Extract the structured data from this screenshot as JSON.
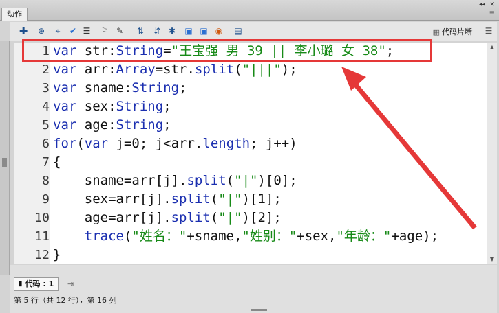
{
  "panel": {
    "tab_label": "动作",
    "window_controls": [
      "◂◂",
      "✕"
    ],
    "menu_icon": "≡"
  },
  "toolbar": {
    "icons": [
      "add-icon",
      "target-icon",
      "crosshair-icon",
      "check-icon",
      "format-icon",
      "debug-icon",
      "script-assist-icon",
      "collapse-icon",
      "expand-icon",
      "expand-all-icon",
      "comment-icon",
      "uncomment-icon",
      "toggle-comment-icon",
      "help-icon"
    ],
    "snippets_label": "代码片断"
  },
  "code": {
    "lines": [
      {
        "n": "1",
        "tokens": [
          [
            "kw",
            "var"
          ],
          [
            "id",
            " str:"
          ],
          [
            "ty",
            "String"
          ],
          [
            "id",
            "="
          ],
          [
            "str",
            "\"王宝强 男 39 || 李小璐 女 38\""
          ],
          [
            "id",
            ";"
          ]
        ]
      },
      {
        "n": "2",
        "tokens": [
          [
            "kw",
            "var"
          ],
          [
            "id",
            " arr:"
          ],
          [
            "ty",
            "Array"
          ],
          [
            "id",
            "=str."
          ],
          [
            "fn",
            "split"
          ],
          [
            "id",
            "("
          ],
          [
            "str",
            "\"|||\""
          ],
          [
            "id",
            ");"
          ]
        ]
      },
      {
        "n": "3",
        "tokens": [
          [
            "kw",
            "var"
          ],
          [
            "id",
            " sname:"
          ],
          [
            "ty",
            "String"
          ],
          [
            "id",
            ";"
          ]
        ]
      },
      {
        "n": "4",
        "tokens": [
          [
            "kw",
            "var"
          ],
          [
            "id",
            " sex:"
          ],
          [
            "ty",
            "String"
          ],
          [
            "id",
            ";"
          ]
        ]
      },
      {
        "n": "5",
        "tokens": [
          [
            "kw",
            "var"
          ],
          [
            "id",
            " age:"
          ],
          [
            "ty",
            "String"
          ],
          [
            "id",
            ";"
          ]
        ]
      },
      {
        "n": "6",
        "tokens": [
          [
            "kw",
            "for"
          ],
          [
            "id",
            "("
          ],
          [
            "kw",
            "var"
          ],
          [
            "id",
            " j=0; j<arr."
          ],
          [
            "fn",
            "length"
          ],
          [
            "id",
            "; j++)"
          ]
        ]
      },
      {
        "n": "7",
        "tokens": [
          [
            "id",
            "{"
          ]
        ]
      },
      {
        "n": "8",
        "tokens": [
          [
            "id",
            "    sname=arr[j]."
          ],
          [
            "fn",
            "split"
          ],
          [
            "id",
            "("
          ],
          [
            "str",
            "\"|\""
          ],
          [
            "id",
            ")[0];"
          ]
        ]
      },
      {
        "n": "9",
        "tokens": [
          [
            "id",
            "    sex=arr[j]."
          ],
          [
            "fn",
            "split"
          ],
          [
            "id",
            "("
          ],
          [
            "str",
            "\"|\""
          ],
          [
            "id",
            ")[1];"
          ]
        ]
      },
      {
        "n": "10",
        "tokens": [
          [
            "id",
            "    age=arr[j]."
          ],
          [
            "fn",
            "split"
          ],
          [
            "id",
            "("
          ],
          [
            "str",
            "\"|\""
          ],
          [
            "id",
            ")[2];"
          ]
        ]
      },
      {
        "n": "11",
        "tokens": [
          [
            "id",
            "    "
          ],
          [
            "fn",
            "trace"
          ],
          [
            "id",
            "("
          ],
          [
            "str",
            "\"姓名：\""
          ],
          [
            "id",
            "+sname,"
          ],
          [
            "str",
            "\"姓别：\""
          ],
          [
            "id",
            "+sex,"
          ],
          [
            "str",
            "\"年龄：\""
          ],
          [
            "id",
            "+age);"
          ]
        ]
      },
      {
        "n": "12",
        "tokens": [
          [
            "id",
            "}"
          ]
        ]
      }
    ]
  },
  "bottom": {
    "code_tab_label": "代码 : 1",
    "status": "第 5 行（共 12 行），第 16 列"
  },
  "colors": {
    "keyword": "#1b2fb0",
    "string": "#178a17",
    "highlight": "#e53838"
  }
}
